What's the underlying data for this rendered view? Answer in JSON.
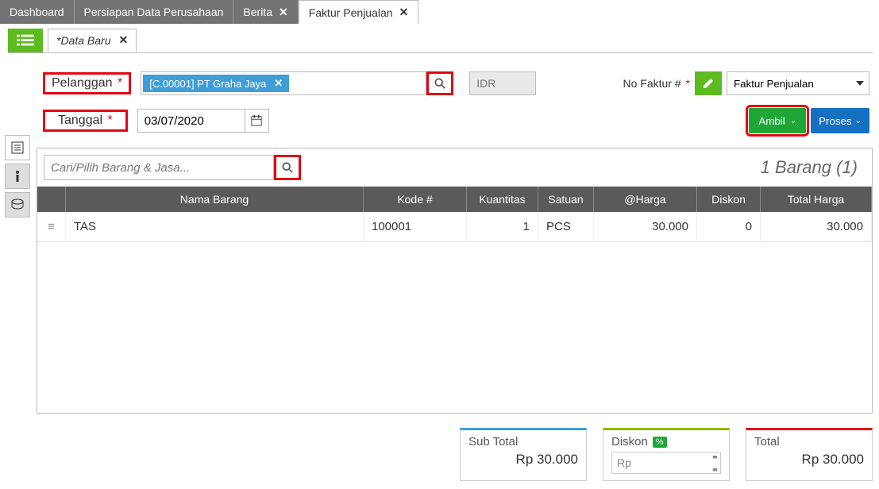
{
  "tabs": [
    {
      "label": "Dashboard",
      "closable": false
    },
    {
      "label": "Persiapan Data Perusahaan",
      "closable": false
    },
    {
      "label": "Berita",
      "closable": true
    },
    {
      "label": "Faktur Penjualan",
      "closable": true,
      "active": true
    }
  ],
  "sub_tab": {
    "label": "*Data Baru"
  },
  "form": {
    "pelanggan_label": "Pelanggan",
    "customer_chip": "[C.00001] PT Graha Jaya",
    "currency": "IDR",
    "nofaktur_label": "No Faktur #",
    "faktur_type": "Faktur Penjualan",
    "tanggal_label": "Tanggal",
    "tanggal_value": "03/07/2020",
    "ambil": "Ambil",
    "proses": "Proses"
  },
  "items": {
    "search_placeholder": "Cari/Pilih Barang & Jasa...",
    "count_text": "1 Barang (1)",
    "headers": {
      "nama": "Nama Barang",
      "kode": "Kode #",
      "qty": "Kuantitas",
      "satuan": "Satuan",
      "harga": "@Harga",
      "diskon": "Diskon",
      "total": "Total Harga"
    },
    "rows": [
      {
        "nama": "TAS",
        "kode": "100001",
        "qty": "1",
        "satuan": "PCS",
        "harga": "30.000",
        "diskon": "0",
        "total": "30.000"
      }
    ]
  },
  "totals": {
    "subtotal_label": "Sub Total",
    "subtotal_value": "Rp 30.000",
    "diskon_label": "Diskon",
    "diskon_pct": "%",
    "diskon_placeholder": "Rp",
    "total_label": "Total",
    "total_value": "Rp 30.000"
  }
}
